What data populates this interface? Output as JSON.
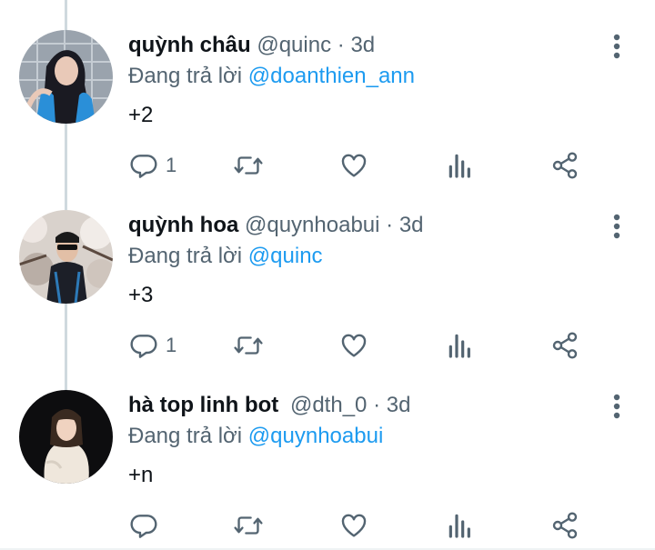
{
  "colors": {
    "text": "#0f1419",
    "muted": "#536471",
    "accent": "#1d9bf0",
    "thread": "#cfd9de"
  },
  "icons": {
    "reply": "reply-icon",
    "retweet": "retweet-icon",
    "like": "heart-icon",
    "views": "analytics-icon",
    "share": "share-icon",
    "more": "more-vertical-icon"
  },
  "tweets": [
    {
      "name": "quỳnh châu",
      "handle": "@quinc",
      "separator": "·",
      "time": "3d",
      "reply_prefix": "Đang trả lời",
      "reply_to": "@doanthien_ann",
      "text": "+2",
      "reply_count": "1"
    },
    {
      "name": "quỳnh hoa",
      "handle": "@quynhoabui",
      "separator": "·",
      "time": "3d",
      "reply_prefix": "Đang trả lời",
      "reply_to": "@quinc",
      "text": "+3",
      "reply_count": "1"
    },
    {
      "name": "hà top linh bot",
      "handle": "@dth_0",
      "separator": "·",
      "time": "3d",
      "reply_prefix": "Đang trả lời",
      "reply_to": "@quynhoabui",
      "text": "+n",
      "reply_count": ""
    }
  ]
}
